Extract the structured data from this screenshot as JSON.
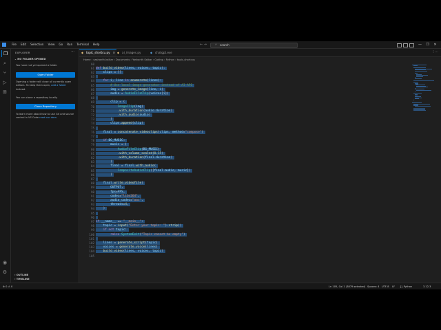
{
  "titlebar": {
    "menu": [
      "File",
      "Edit",
      "Selection",
      "View",
      "Go",
      "Run",
      "Terminal",
      "Help"
    ],
    "search_text": "search",
    "window_controls": [
      "—",
      "❐",
      "✕"
    ]
  },
  "sidebar": {
    "title": "EXPLORER",
    "section": "NO FOLDER OPENED",
    "msg1": "You have not yet opened a folder.",
    "open_folder_label": "Open Folder",
    "msg2_a": "Opening a folder will close all currently open editors. To keep them open,",
    "msg2_link": "add a folder",
    "msg2_b": "instead.",
    "msg3": "You can clone a repository locally.",
    "clone_label": "Clone Repository",
    "msg4_a": "To learn more about how to use Git and source control in VS Code",
    "msg4_link": "read our docs",
    "outline": "OUTLINE",
    "timeline": "TIMELINE"
  },
  "tabs": [
    {
      "label": "topic_shortcu.py",
      "active": true
    },
    {
      "label": "ai_images.py",
      "active": false
    },
    {
      "label": "chatgpt.exe",
      "active": false
    }
  ],
  "breadcrumb": "Home › yashanth-kalkar › Documents › Yashanth Kalkar › Coding › Python › topic_shortcus",
  "editor": {
    "first_line_number": 60,
    "lines": [
      "",
      "def build_video(lines, voices, topic):",
      "    clips = []",
      "",
      "    for i, line in enumerate(lines):",
      "        # Use local image generator instead of AI API",
      "        img = generate_image(line, i)",
      "        audio = AudioFileClip(voices[i])",
      "",
      "        clip = (",
      "            ImageClip(img)",
      "            .with_duration(audio.duration)",
      "            .with_audio(audio)",
      "        )",
      "        clips.append(clip)",
      "",
      "    final = concatenate_videoclips(clips, method=\"compose\")",
      "",
      "    if BG_MUSIC:",
      "        music = (",
      "            AudioFileClip(BG_MUSIC)",
      "            .with_volume_scaled(0.15)",
      "            .with_duration(final.duration)",
      "        )",
      "        final = final.with_audio(",
      "            CompositeAudioClip([final.audio, music])",
      "        )",
      "",
      "    final.write_videofile(",
      "        OUTPUT,",
      "        fps=FPS,",
      "        codec=\"libx264\",",
      "        audio_codec=\"aac\",",
      "        threads=4,",
      "    )",
      "",
      "",
      "if __name__ == \"__main__\":",
      "    topic = input(\"Enter your topic: \").strip()",
      "    if not topic:",
      "        raise SystemExit(\"Topic cannot be empty\")",
      "",
      "    lines = generate_script(topic)",
      "    voices = generate_voice(lines)",
      "    build_video(lines, voices, topic)",
      ""
    ]
  },
  "statusbar": {
    "left": "⊗ 0  ⚠ 0",
    "position": "Ln 105, Col 1 (3879 selected)",
    "spaces": "Spaces: 4",
    "encoding": "UTF-8",
    "eol": "LF",
    "language": "{} Python",
    "version": "3.12.3"
  },
  "colors": {
    "accent": "#0078d4",
    "selection": "#264f78"
  }
}
